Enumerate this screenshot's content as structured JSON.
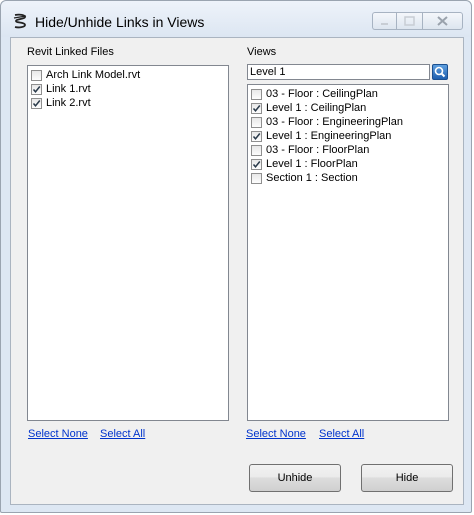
{
  "window": {
    "title": "Hide/Unhide Links in Views"
  },
  "linked_files": {
    "label": "Revit Linked Files",
    "items": [
      {
        "label": "Arch Link Model.rvt",
        "checked": false
      },
      {
        "label": "Link 1.rvt",
        "checked": true
      },
      {
        "label": "Link 2.rvt",
        "checked": true
      }
    ],
    "select_none": "Select None",
    "select_all": "Select All"
  },
  "views": {
    "label": "Views",
    "search_value": "Level 1",
    "items": [
      {
        "label": "03 - Floor : CeilingPlan",
        "checked": false
      },
      {
        "label": "Level 1 : CeilingPlan",
        "checked": true
      },
      {
        "label": "03 - Floor : EngineeringPlan",
        "checked": false
      },
      {
        "label": "Level 1 : EngineeringPlan",
        "checked": true
      },
      {
        "label": "03 - Floor : FloorPlan",
        "checked": false
      },
      {
        "label": "Level 1 : FloorPlan",
        "checked": true
      },
      {
        "label": "Section 1 : Section",
        "checked": false
      }
    ],
    "select_none": "Select None",
    "select_all": "Select All"
  },
  "actions": {
    "unhide_label": "Unhide",
    "hide_label": "Hide"
  }
}
